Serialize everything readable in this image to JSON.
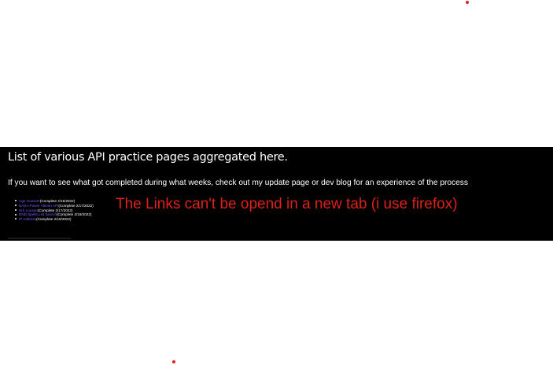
{
  "panel": {
    "heading": "List of various API practice pages aggregated here.",
    "intro": "If you want to see what got completed during what weeks, check out my update page or dev blog for an experience of the process",
    "items": [
      {
        "link": "Age Guesser",
        "status": "(Complete 2/15/2022)"
      },
      {
        "link": "NASA Power Albedo API",
        "status": "(Complete 2/17/2022)"
      },
      {
        "link": "ISS Locator",
        "status": "(Complete 2/17/2022)"
      },
      {
        "link": "DND Spells List Search",
        "status": "(Complete 2/18/2022)"
      },
      {
        "link": "IP Address",
        "status": "(Complete 2/18/2022)"
      }
    ]
  },
  "annotation": {
    "text": "The Links can't be opend in a new tab (i use firefox)"
  },
  "colors": {
    "panel_background": "#000000",
    "link": "#7a5cff",
    "annotation": "#e0201a",
    "page_background": "#ffffff"
  }
}
